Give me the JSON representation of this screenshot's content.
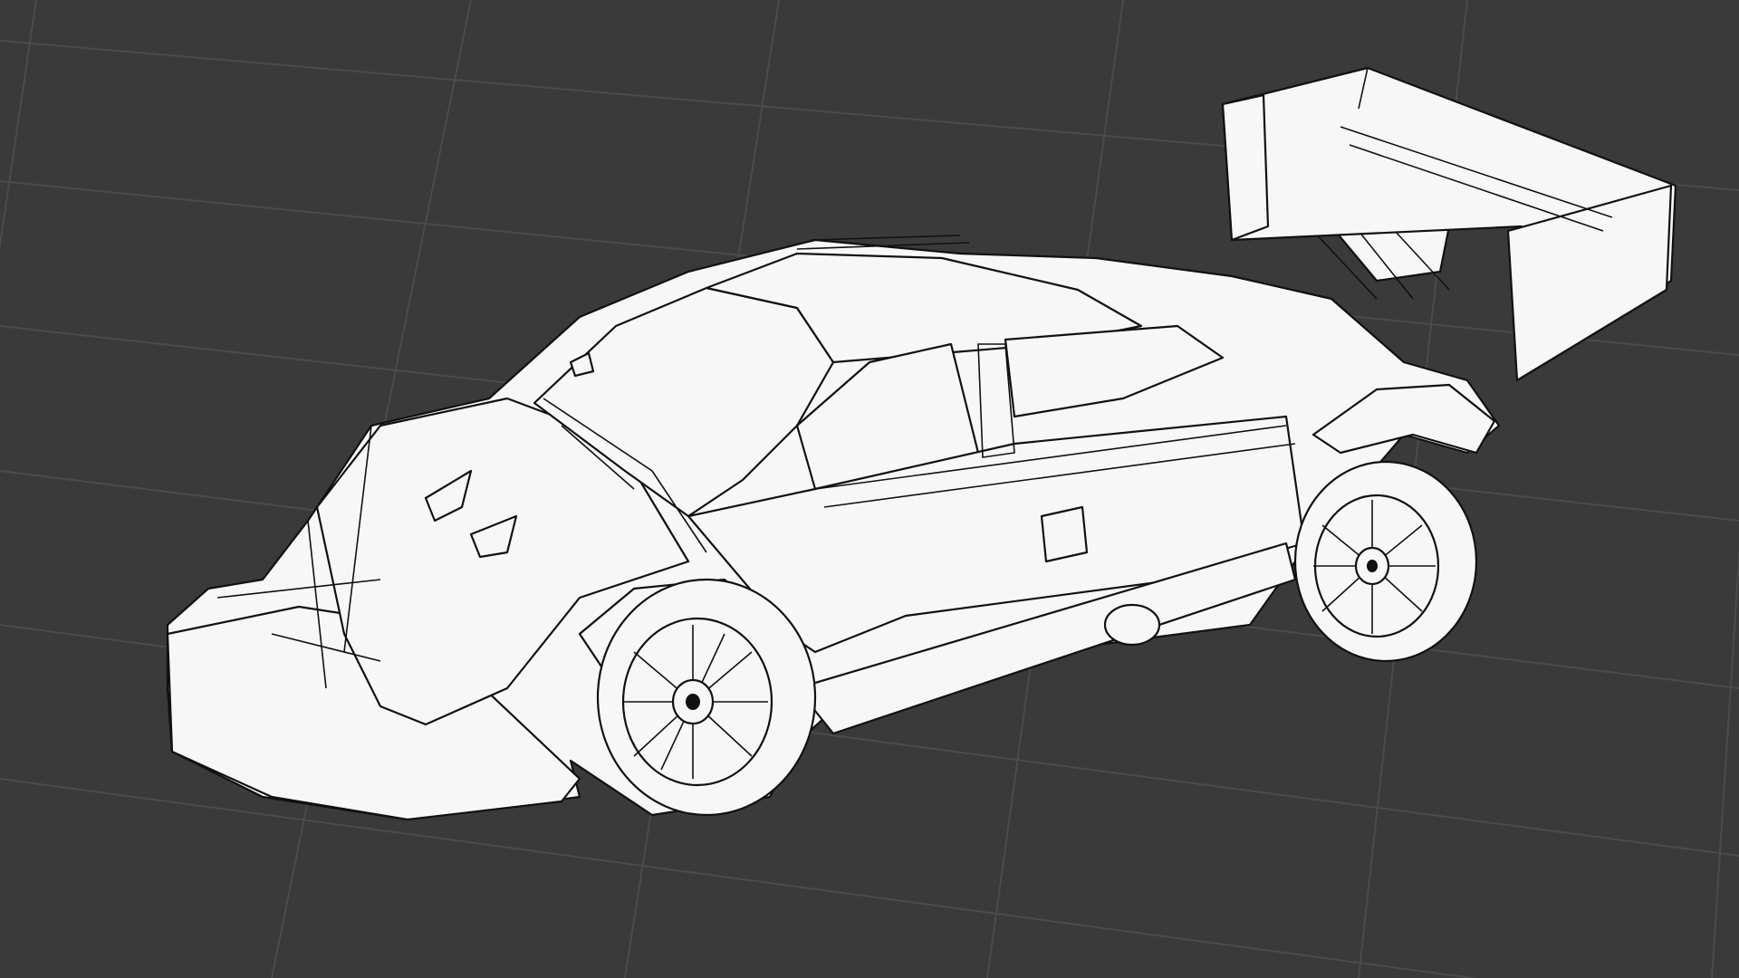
{
  "scene": {
    "background_color": "#3a3a3a",
    "grid_color": "#4a4a4a",
    "wireframe_fill": "#f7f7f7",
    "wireframe_stroke": "#111111",
    "object": "car-wireframe"
  }
}
